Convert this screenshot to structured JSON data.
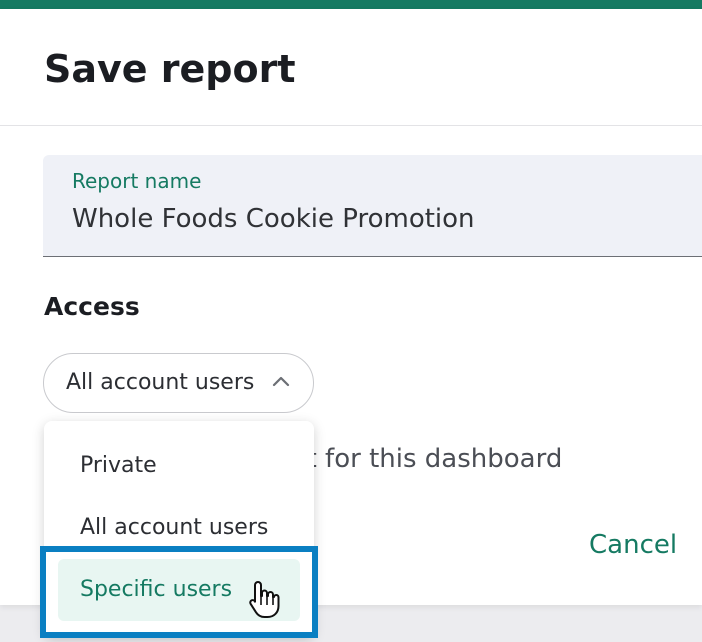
{
  "colors": {
    "accent": "#157a62",
    "highlight": "#0a7fc2",
    "selected_bg": "#e8f6f2"
  },
  "dialog": {
    "title": "Save report"
  },
  "report_name_field": {
    "label": "Report name",
    "value": "Whole Foods Cookie Promotion"
  },
  "access": {
    "heading": "Access",
    "selected_value": "All account users",
    "expanded": true,
    "options": [
      {
        "label": "Private"
      },
      {
        "label": "All account users"
      },
      {
        "label": "Specific users",
        "hovered": true
      }
    ]
  },
  "partially_hidden_text": "ort for this dashboard",
  "actions": {
    "cancel_label": "Cancel"
  },
  "icons": {
    "select_toggle": "chevron-up-icon",
    "pointer": "hand-pointer-icon"
  }
}
